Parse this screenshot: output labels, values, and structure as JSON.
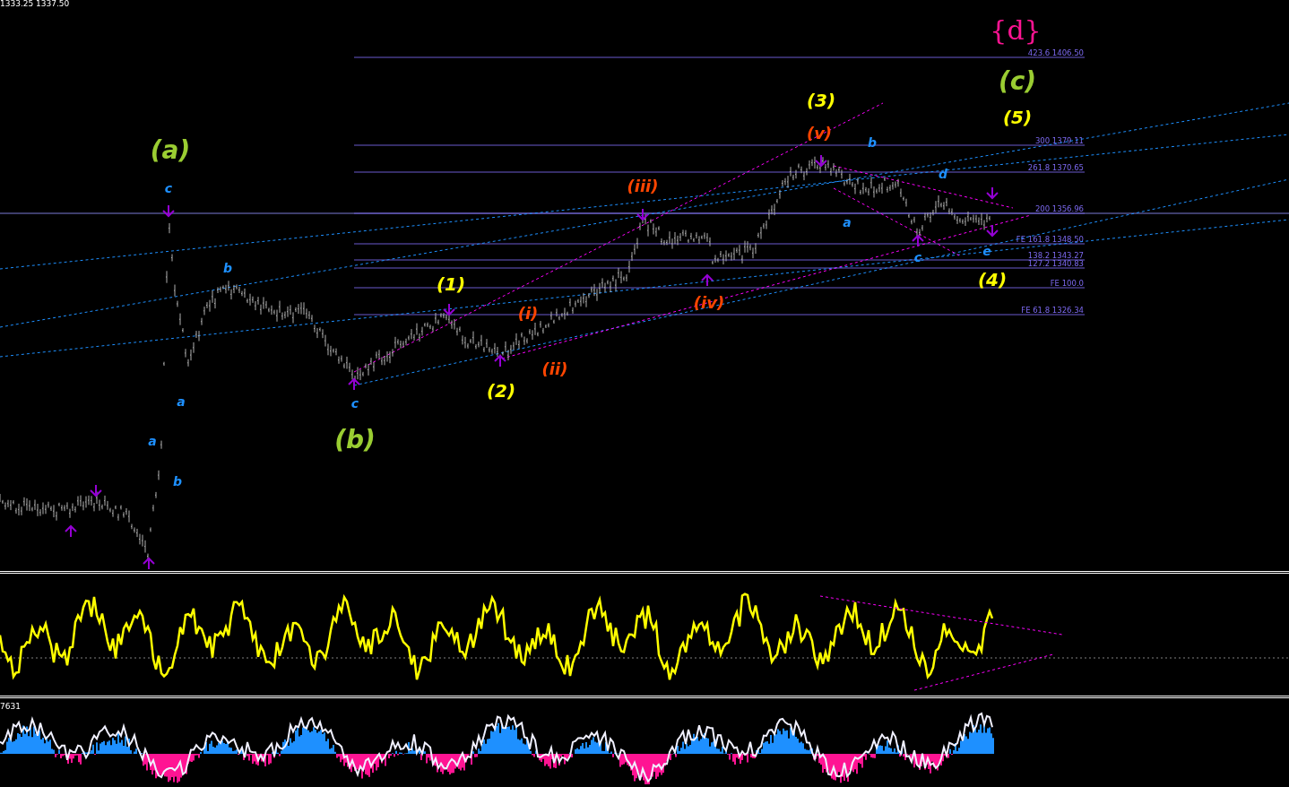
{
  "main_chart": {
    "price_readout": "1333.25 1337.50",
    "wave_labels": [
      {
        "text": "{d}",
        "color": "#ff1493",
        "kind": "serif"
      },
      {
        "text": "(c)",
        "color": "#9acd32",
        "kind": "wave"
      },
      {
        "text": "(5)",
        "color": "#ffff00",
        "kind": "wave"
      },
      {
        "text": "(3)",
        "color": "#ffff00",
        "kind": "wave"
      },
      {
        "text": "(v)",
        "color": "#ff4500",
        "kind": "wave"
      },
      {
        "text": "b",
        "color": "#1e90ff",
        "kind": "wave"
      },
      {
        "text": "d",
        "color": "#1e90ff",
        "kind": "wave"
      },
      {
        "text": "(iii)",
        "color": "#ff4500",
        "kind": "wave"
      },
      {
        "text": "a",
        "color": "#1e90ff",
        "kind": "wave"
      },
      {
        "text": "c",
        "color": "#1e90ff",
        "kind": "wave"
      },
      {
        "text": "e",
        "color": "#1e90ff",
        "kind": "wave"
      },
      {
        "text": "(4)",
        "color": "#ffff00",
        "kind": "wave"
      },
      {
        "text": "(iv)",
        "color": "#ff4500",
        "kind": "wave"
      },
      {
        "text": "(1)",
        "color": "#ffff00",
        "kind": "wave"
      },
      {
        "text": "(i)",
        "color": "#ff4500",
        "kind": "wave"
      },
      {
        "text": "(ii)",
        "color": "#ff4500",
        "kind": "wave"
      },
      {
        "text": "(2)",
        "color": "#ffff00",
        "kind": "wave"
      },
      {
        "text": "(a)",
        "color": "#9acd32",
        "kind": "wave"
      },
      {
        "text": "c",
        "color": "#1e90ff",
        "kind": "wave"
      },
      {
        "text": "b",
        "color": "#1e90ff",
        "kind": "wave"
      },
      {
        "text": "a",
        "color": "#1e90ff",
        "kind": "wave"
      },
      {
        "text": "a",
        "color": "#1e90ff",
        "kind": "wave"
      },
      {
        "text": "b",
        "color": "#1e90ff",
        "kind": "wave"
      },
      {
        "text": "c",
        "color": "#1e90ff",
        "kind": "wave"
      },
      {
        "text": "(b)",
        "color": "#9acd32",
        "kind": "wave"
      }
    ],
    "fib_levels": [
      {
        "label": "423.6 1406.50"
      },
      {
        "label": "300 1379.11"
      },
      {
        "label": "261.8 1370.65"
      },
      {
        "label": "200 1356.96"
      },
      {
        "label": "FE 161.8 1348.50"
      },
      {
        "label": "138.2 1343.27"
      },
      {
        "label": "127.2 1340.83"
      },
      {
        "label": "FE 100.0"
      },
      {
        "label": "FE 61.8 1326.34"
      }
    ]
  },
  "histogram_panel": {
    "readout": "7631"
  }
}
